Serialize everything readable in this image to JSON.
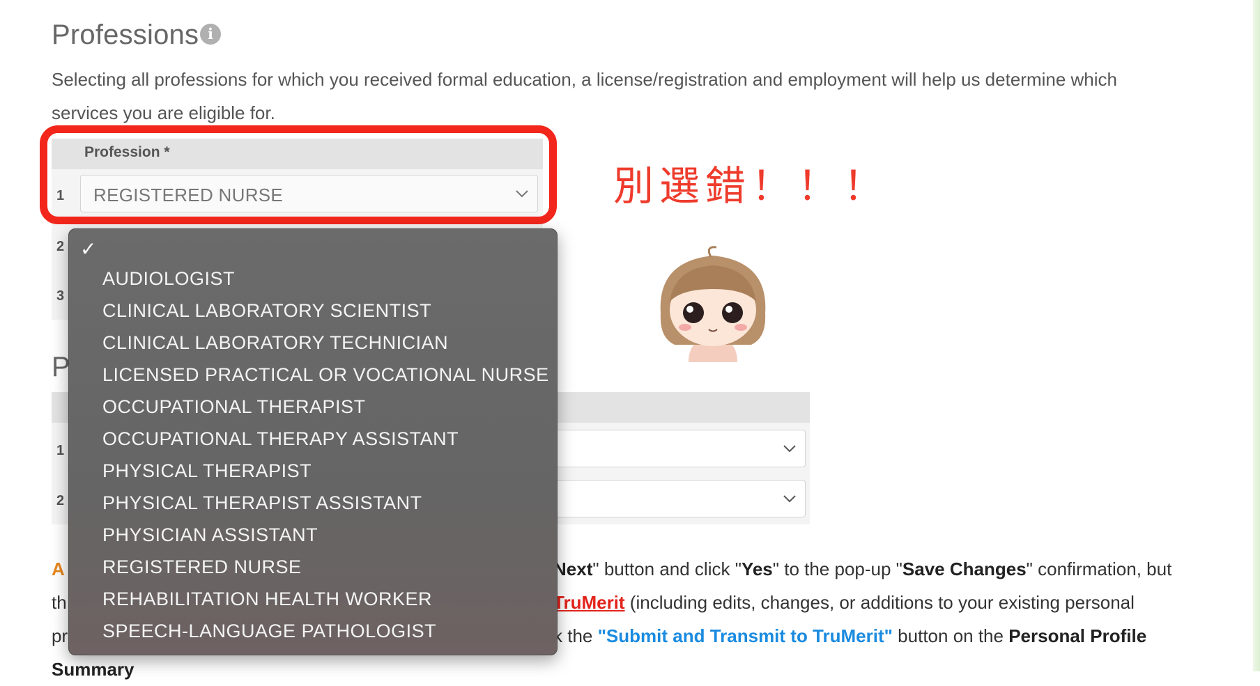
{
  "professions": {
    "title": "Professions",
    "info_icon": "info-icon",
    "description": "Selecting all professions for which you received formal education, a license/registration and employment will help us determine which services you are eligible for.",
    "table": {
      "header": "Profession *",
      "rows": [
        {
          "number": "1",
          "selected": "REGISTERED NURSE"
        },
        {
          "number": "2",
          "selected": ""
        },
        {
          "number": "3",
          "selected": ""
        }
      ]
    }
  },
  "annotation": {
    "text": "別選錯！！！",
    "color": "#ee3b2c",
    "sticker": "chibi-girl-sticker"
  },
  "dropdown": {
    "checkmark": "✓",
    "options": [
      "AUDIOLOGIST",
      "CLINICAL LABORATORY SCIENTIST",
      "CLINICAL LABORATORY TECHNICIAN",
      "LICENSED PRACTICAL OR VOCATIONAL NURSE",
      "OCCUPATIONAL THERAPIST",
      "OCCUPATIONAL THERAPY ASSISTANT",
      "PHYSICAL THERAPIST",
      "PHYSICAL THERAPIST ASSISTANT",
      "PHYSICIAN ASSISTANT",
      "REGISTERED NURSE",
      "REHABILITATION HEALTH WORKER",
      "SPEECH-LANGUAGE PATHOLOGIST"
    ]
  },
  "section2": {
    "title_initial": "P",
    "rows": [
      {
        "number": "1"
      },
      {
        "number": "2"
      }
    ]
  },
  "notice": {
    "line1": {
      "prefix": "A",
      "bold_next": "Next",
      "text1": "\" button and click \"",
      "yes": "Yes",
      "text2": "\" to the pop-up \"",
      "save_changes": "Save Changes",
      "text3": "\" confirmation, but"
    },
    "line2": {
      "prefix": "th",
      "link": "TruMerit",
      "text": " (including edits, changes, or additions to your existing personal"
    },
    "line3": {
      "prefix": "pr",
      "text1": "k the ",
      "link": "\"Submit and Transmit to TruMerit\"",
      "text2": " button on the ",
      "bold": "Personal Profile"
    },
    "line4": {
      "bold": "Summary"
    }
  },
  "colors": {
    "highlight_border": "#f2261b",
    "alert_orange": "#e8871e",
    "link_red": "#e2231a",
    "link_blue": "#1a8be0",
    "dropdown_bg": "#676767"
  }
}
